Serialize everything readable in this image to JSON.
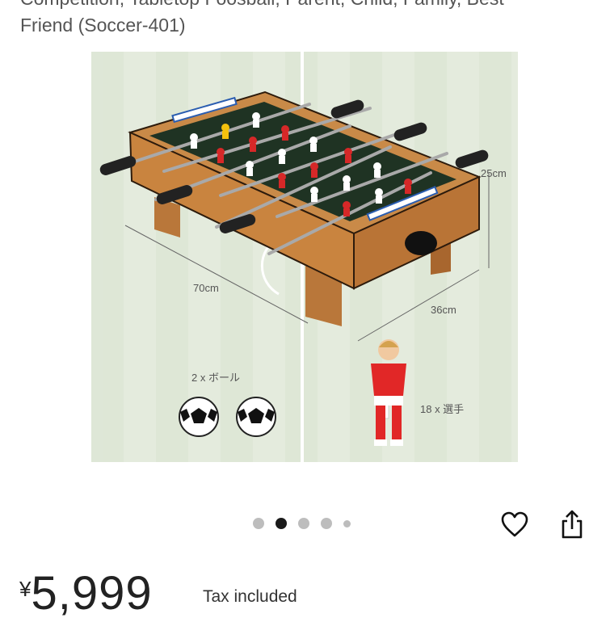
{
  "product": {
    "title_line1": "Competition, Tabletop Foosball, Parent, Child, Family, Best",
    "title_line2": "Friend (Soccer-401)"
  },
  "image": {
    "labels": {
      "width": "70cm",
      "depth": "36cm",
      "height": "25cm",
      "balls": "2 x ボール",
      "players": "18 x 選手"
    }
  },
  "carousel": {
    "count": 5,
    "active_index": 1
  },
  "actions": {
    "favorite_icon": "heart-icon",
    "share_icon": "share-icon"
  },
  "price": {
    "currency": "¥",
    "amount": "5,999",
    "tax_note": "Tax included"
  },
  "colors": {
    "active_dot": "#1a1a1a",
    "inactive_dot": "#bdbdbd",
    "background_field": "#e4ebdd"
  }
}
